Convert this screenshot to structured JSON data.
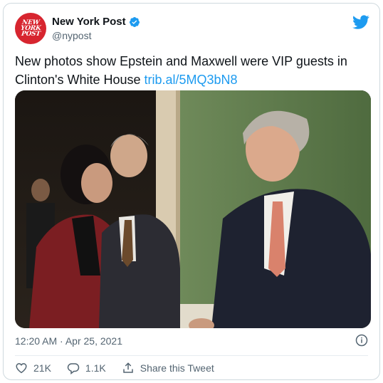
{
  "account": {
    "display_name": "New York Post",
    "handle": "@nypost",
    "logo_lines": [
      "NEW",
      "YORK",
      "POST"
    ]
  },
  "tweet": {
    "text": "New photos show Epstein and Maxwell were VIP guests in Clinton's White House ",
    "link": "trib.al/5MQ3bN8",
    "timestamp": "12:20 AM · Apr 25, 2021"
  },
  "actions": {
    "likes": "21K",
    "replies": "1.1K",
    "share_label": "Share this Tweet"
  },
  "colors": {
    "link": "#1d9bf0",
    "brand_red": "#d7252f",
    "secondary_text": "#536471"
  },
  "icons": [
    "verified-badge-icon",
    "twitter-bird-icon",
    "info-icon",
    "heart-icon",
    "reply-icon",
    "share-icon"
  ]
}
